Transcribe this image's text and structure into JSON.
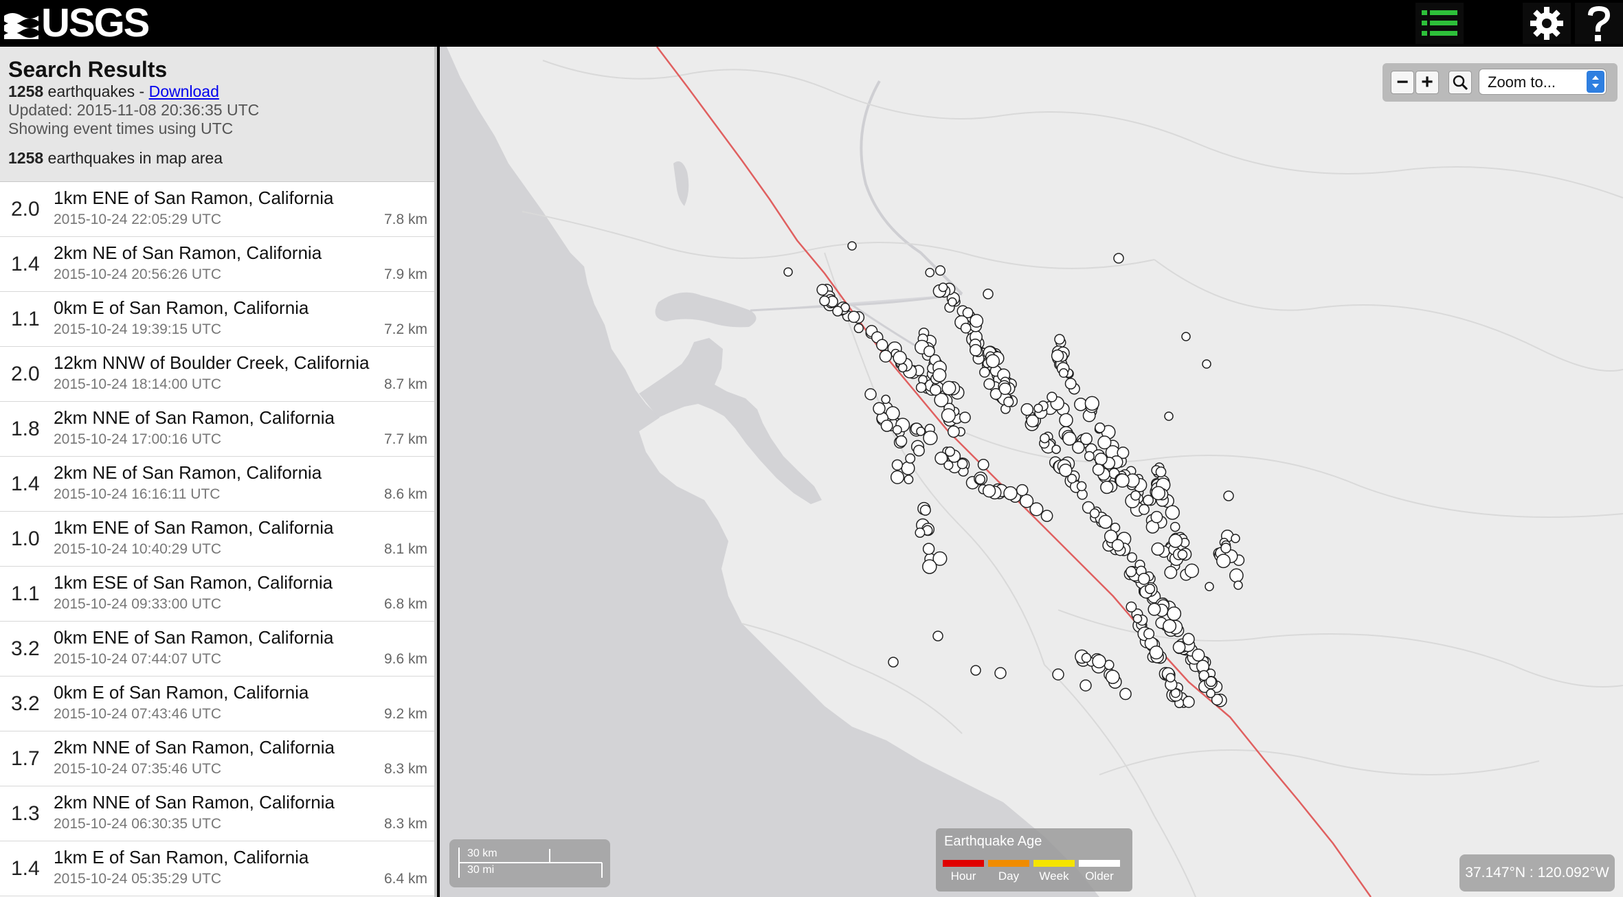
{
  "header": {
    "logo_text": "USGS",
    "buttons": [
      {
        "name": "list-icon",
        "color": "#2ec03a"
      },
      {
        "name": "map-icon",
        "color": "#2ec03a"
      },
      {
        "name": "gear-icon",
        "color": "#ffffff"
      },
      {
        "name": "help-icon",
        "color": "#ffffff"
      }
    ]
  },
  "summary": {
    "title": "Search Results",
    "total_count": "1258",
    "total_suffix": " earthquakes - ",
    "download_label": "Download",
    "updated": "Updated: 2015-11-08 20:36:35 UTC",
    "timezone_note": "Showing event times using UTC",
    "map_count": "1258",
    "map_count_suffix": " earthquakes in map area"
  },
  "earthquakes": [
    {
      "mag": "2.0",
      "place": "1km ENE of San Ramon, California",
      "time": "2015-10-24 22:05:29 UTC",
      "depth": "7.8 km"
    },
    {
      "mag": "1.4",
      "place": "2km NE of San Ramon, California",
      "time": "2015-10-24 20:56:26 UTC",
      "depth": "7.9 km"
    },
    {
      "mag": "1.1",
      "place": "0km E of San Ramon, California",
      "time": "2015-10-24 19:39:15 UTC",
      "depth": "7.2 km"
    },
    {
      "mag": "2.0",
      "place": "12km NNW of Boulder Creek, California",
      "time": "2015-10-24 18:14:00 UTC",
      "depth": "8.7 km"
    },
    {
      "mag": "1.8",
      "place": "2km NNE of San Ramon, California",
      "time": "2015-10-24 17:00:16 UTC",
      "depth": "7.7 km"
    },
    {
      "mag": "1.4",
      "place": "2km NE of San Ramon, California",
      "time": "2015-10-24 16:16:11 UTC",
      "depth": "8.6 km"
    },
    {
      "mag": "1.0",
      "place": "1km ENE of San Ramon, California",
      "time": "2015-10-24 10:40:29 UTC",
      "depth": "8.1 km"
    },
    {
      "mag": "1.1",
      "place": "1km ESE of San Ramon, California",
      "time": "2015-10-24 09:33:00 UTC",
      "depth": "6.8 km"
    },
    {
      "mag": "3.2",
      "place": "0km ENE of San Ramon, California",
      "time": "2015-10-24 07:44:07 UTC",
      "depth": "9.6 km"
    },
    {
      "mag": "3.2",
      "place": "0km E of San Ramon, California",
      "time": "2015-10-24 07:43:46 UTC",
      "depth": "9.2 km"
    },
    {
      "mag": "1.7",
      "place": "2km NNE of San Ramon, California",
      "time": "2015-10-24 07:35:46 UTC",
      "depth": "8.3 km"
    },
    {
      "mag": "1.3",
      "place": "2km NNE of San Ramon, California",
      "time": "2015-10-24 06:30:35 UTC",
      "depth": "8.3 km"
    },
    {
      "mag": "1.4",
      "place": "1km E of San Ramon, California",
      "time": "2015-10-24 05:35:29 UTC",
      "depth": "6.4 km"
    }
  ],
  "map": {
    "zoom_out_label": "−",
    "zoom_in_label": "+",
    "zoom_select_value": "Zoom to...",
    "scale_km": "30 km",
    "scale_mi": "30 mi",
    "legend_title": "Earthquake Age",
    "legend_items": [
      {
        "label": "Hour",
        "color": "#e00000"
      },
      {
        "label": "Day",
        "color": "#f08c00"
      },
      {
        "label": "Week",
        "color": "#f5e400"
      },
      {
        "label": "Older",
        "color": "#ffffff"
      }
    ],
    "coordinates": "37.147°N : 120.092°W",
    "fault_color": "#e06060",
    "ocean_color": "#d3d3d6",
    "land_color": "#ececec"
  }
}
